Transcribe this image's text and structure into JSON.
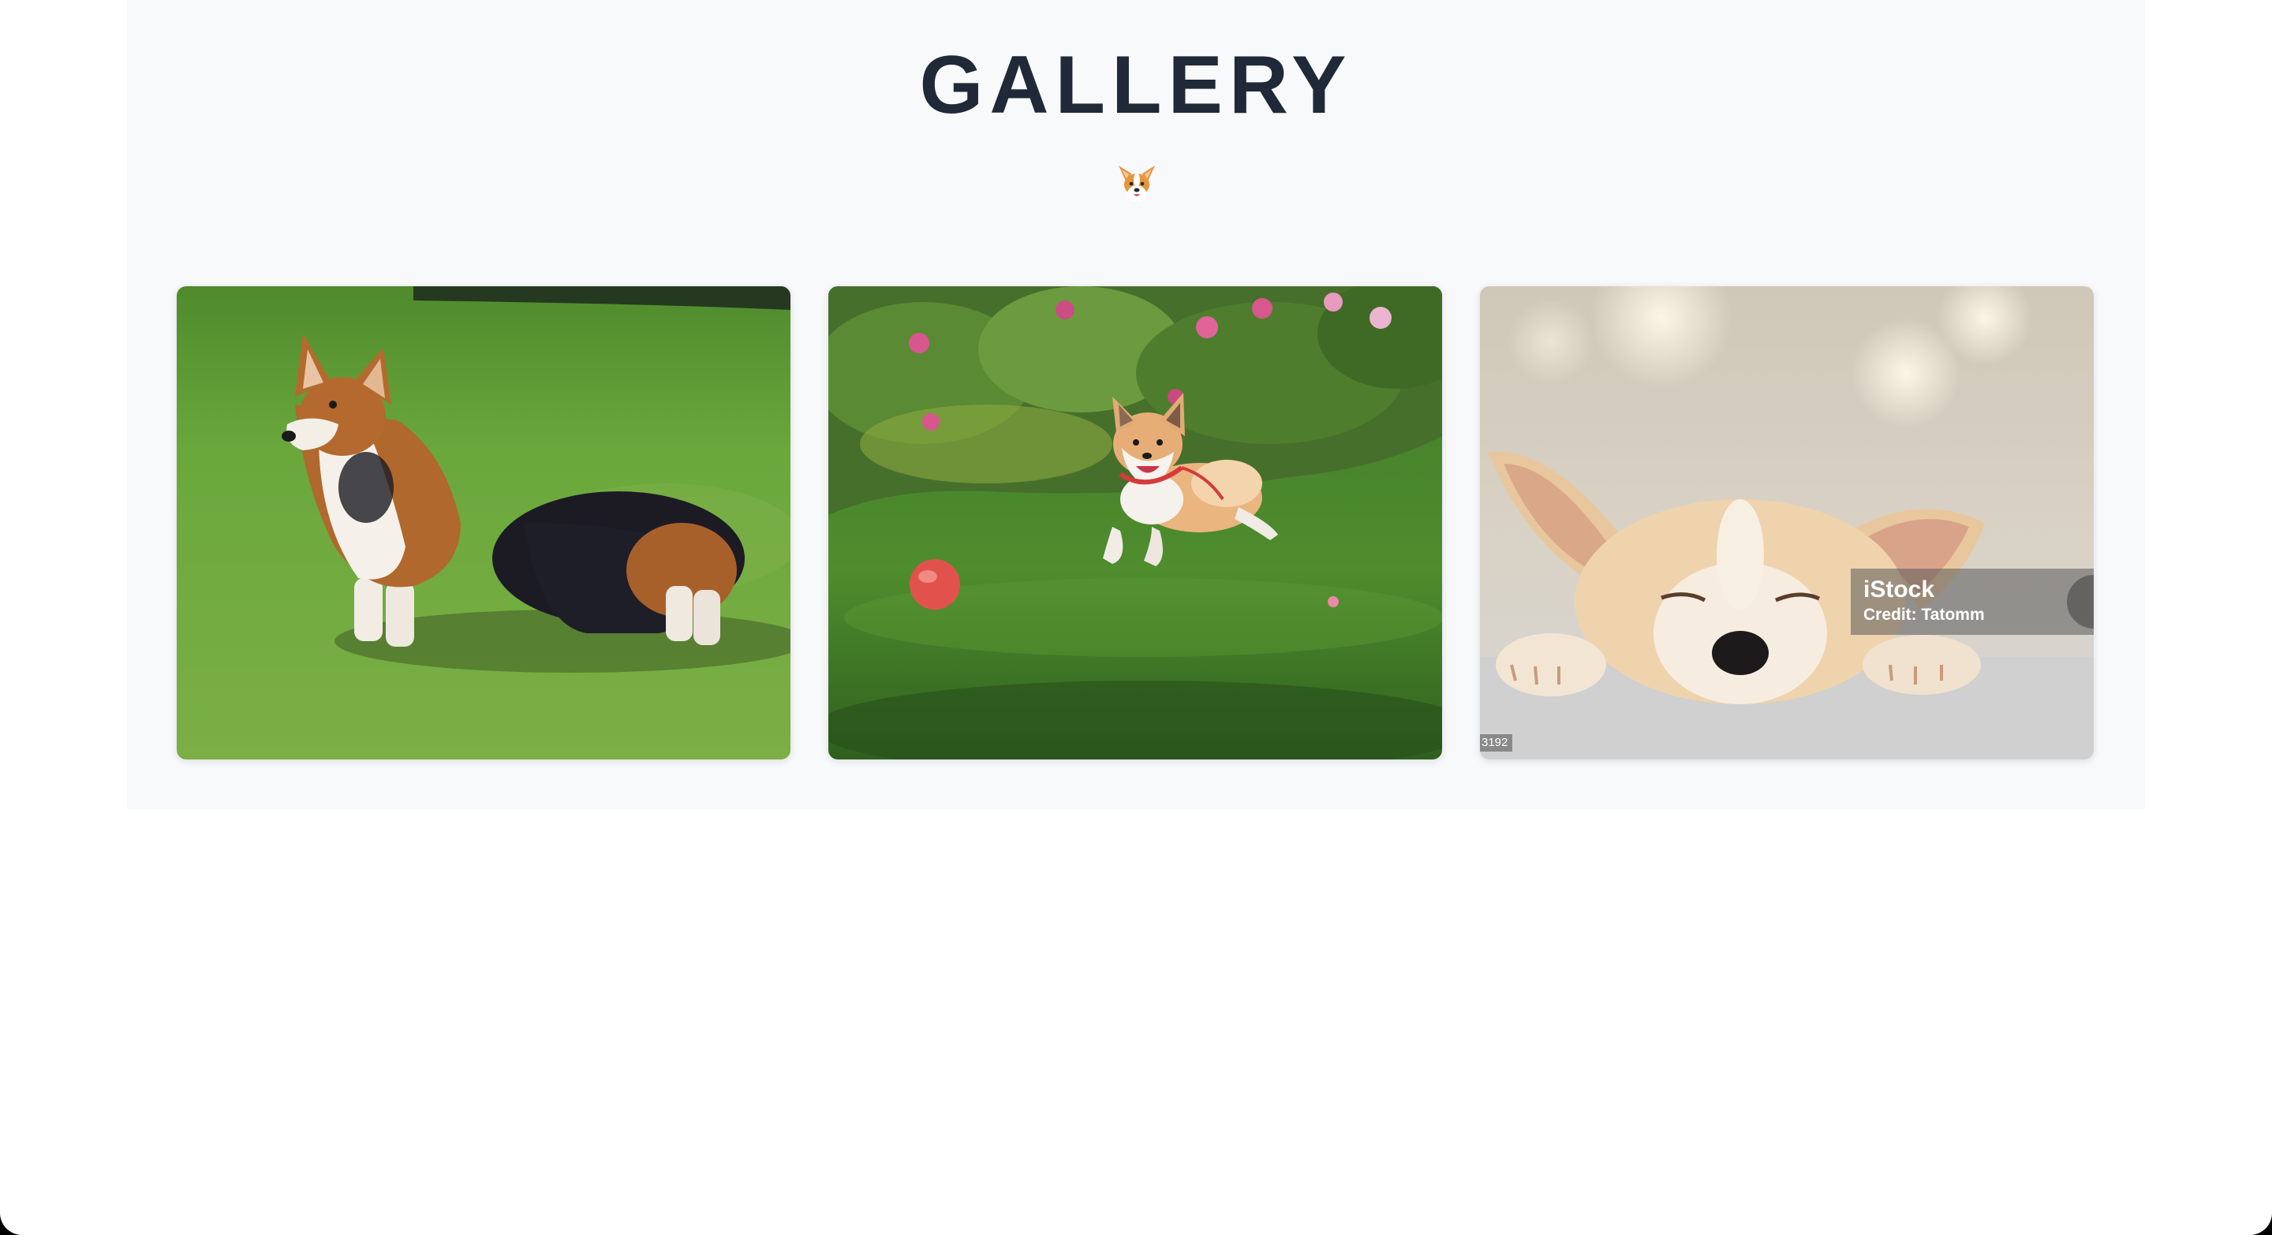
{
  "gallery": {
    "title": "GALLERY",
    "emblem_icon": "corgi-face-icon",
    "photos": [
      {
        "subject": "corgi-standing-on-grass"
      },
      {
        "subject": "corgi-running-with-ball"
      },
      {
        "subject": "sleeping-corgi-puppy",
        "watermark_brand": "iStock",
        "watermark_credit": "Credit: Tatomm",
        "image_id": "3192"
      }
    ]
  },
  "colors": {
    "page_background": "#ffffff",
    "section_background": "#f8f9fb",
    "title_text": "#1f2937",
    "emblem_orange": "#e8953a",
    "grass_green": "#5f9a35"
  }
}
